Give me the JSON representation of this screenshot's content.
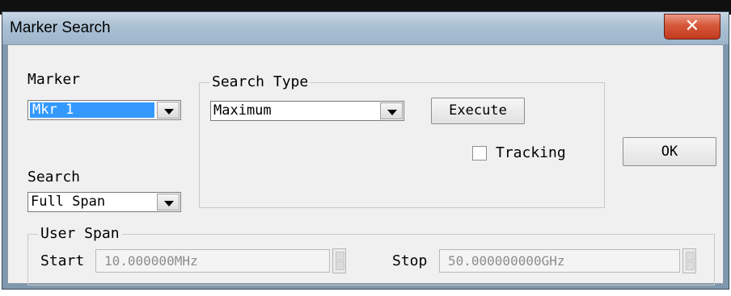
{
  "window": {
    "title": "Marker Search",
    "close_icon": "close-icon"
  },
  "marker": {
    "label": "Marker",
    "value": "Mkr 1"
  },
  "search": {
    "label": "Search",
    "value": "Full Span"
  },
  "search_type": {
    "group_title": "Search Type",
    "value": "Maximum",
    "execute_label": "Execute",
    "tracking_label": "Tracking",
    "tracking_checked": false
  },
  "ok_label": "OK",
  "user_span": {
    "group_title": "User Span",
    "start_label": "Start",
    "start_value": "10.000000MHz",
    "stop_label": "Stop",
    "stop_value": "50.000000000GHz"
  },
  "colors": {
    "selection": "#3399ff",
    "close_button": "#d6573a",
    "titlebar": "#aac0d4"
  }
}
